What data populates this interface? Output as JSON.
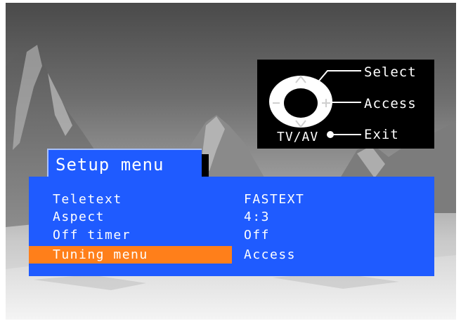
{
  "help": {
    "select_label": "Select",
    "access_label": "Access",
    "exit_label": "Exit",
    "tvav_label": "TV/AV"
  },
  "menu": {
    "title": "Setup menu",
    "items": [
      {
        "label": "Teletext",
        "value": "FASTEXT",
        "highlighted": false
      },
      {
        "label": "Aspect",
        "value": "4:3",
        "highlighted": false
      },
      {
        "label": "Off timer",
        "value": "Off",
        "highlighted": false
      },
      {
        "label": "Tuning menu",
        "value": "Access",
        "highlighted": true
      }
    ]
  },
  "colors": {
    "menu_blue": "#1f5bff",
    "highlight_orange": "#ff7f1a",
    "help_background": "#000000",
    "text": "#ffffff"
  },
  "icons": [
    "remote-dpad-icon",
    "tvav-button-icon"
  ]
}
